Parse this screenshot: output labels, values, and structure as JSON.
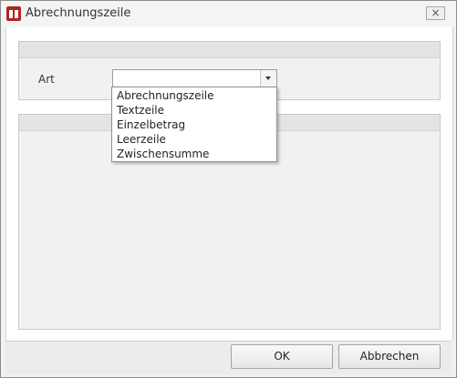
{
  "window": {
    "title": "Abrechnungszeile",
    "close_label": "×"
  },
  "form": {
    "art_label": "Art",
    "art_value": "",
    "art_options": [
      "Abrechnungszeile",
      "Textzeile",
      "Einzelbetrag",
      "Leerzeile",
      "Zwischensumme"
    ]
  },
  "footer": {
    "ok_label": "OK",
    "cancel_label": "Abbrechen"
  },
  "colors": {
    "app_icon": "#b42323"
  },
  "icons": {
    "app": "app-logo-icon",
    "close": "close-icon",
    "dropdown": "chevron-down-icon"
  }
}
